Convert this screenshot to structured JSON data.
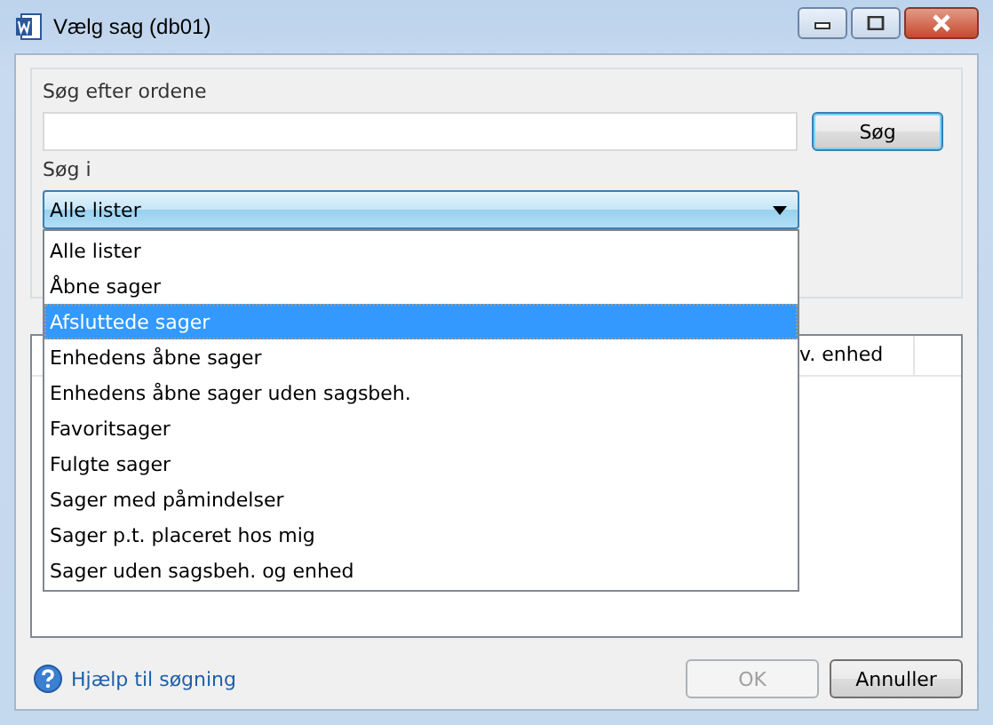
{
  "window": {
    "title": "Vælg sag (db01)"
  },
  "search": {
    "label": "Søg efter ordene",
    "button": "Søg"
  },
  "scope": {
    "label": "Søg i",
    "value": "Alle lister",
    "expanded": true,
    "options": [
      {
        "label": "Alle lister",
        "highlighted": false
      },
      {
        "label": "Åbne sager",
        "highlighted": false
      },
      {
        "label": "Afsluttede sager",
        "highlighted": true
      },
      {
        "label": "Enhedens åbne sager",
        "highlighted": false
      },
      {
        "label": "Enhedens åbne sager uden sagsbeh.",
        "highlighted": false
      },
      {
        "label": "Favoritsager",
        "highlighted": false
      },
      {
        "label": "Fulgte sager",
        "highlighted": false
      },
      {
        "label": "Sager med påmindelser",
        "highlighted": false
      },
      {
        "label": "Sager p.t. placeret hos mig",
        "highlighted": false
      },
      {
        "label": "Sager uden sagsbeh. og enhed",
        "highlighted": false
      }
    ]
  },
  "table": {
    "columns": [
      "v. enhed"
    ]
  },
  "help_link": "Hjælp til søgning",
  "buttons": [
    {
      "label": "OK",
      "disabled": true
    },
    {
      "label": "Annuller",
      "disabled": false
    }
  ]
}
